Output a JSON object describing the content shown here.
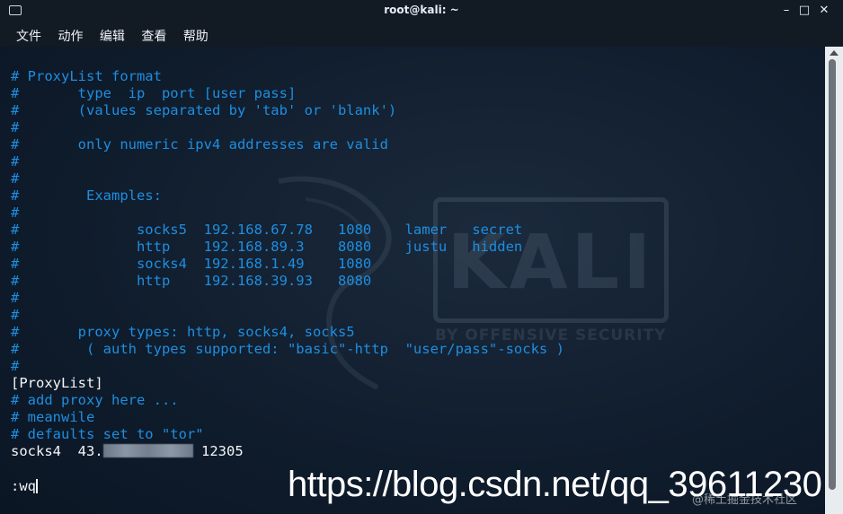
{
  "window": {
    "title": "root@kali: ~",
    "controls": {
      "minimize": "–",
      "maximize": "□",
      "close": "✕"
    }
  },
  "menu": [
    "文件",
    "动作",
    "编辑",
    "查看",
    "帮助"
  ],
  "terminal": {
    "lines": [
      {
        "text": "# ProxyList format",
        "style": "comment"
      },
      {
        "text": "#       type  ip  port [user pass]",
        "style": "comment"
      },
      {
        "text": "#       (values separated by 'tab' or 'blank')",
        "style": "comment"
      },
      {
        "text": "#",
        "style": "comment"
      },
      {
        "text": "#       only numeric ipv4 addresses are valid",
        "style": "comment"
      },
      {
        "text": "#",
        "style": "comment"
      },
      {
        "text": "#",
        "style": "comment"
      },
      {
        "text": "#        Examples:",
        "style": "comment"
      },
      {
        "text": "#",
        "style": "comment"
      },
      {
        "text": "#              socks5  192.168.67.78   1080    lamer   secret",
        "style": "comment"
      },
      {
        "text": "#              http    192.168.89.3    8080    justu   hidden",
        "style": "comment"
      },
      {
        "text": "#              socks4  192.168.1.49    1080",
        "style": "comment"
      },
      {
        "text": "#              http    192.168.39.93   8080",
        "style": "comment"
      },
      {
        "text": "#",
        "style": "comment"
      },
      {
        "text": "#",
        "style": "comment"
      },
      {
        "text": "#       proxy types: http, socks4, socks5",
        "style": "comment"
      },
      {
        "text": "#        ( auth types supported: \"basic\"-http  \"user/pass\"-socks )",
        "style": "comment"
      },
      {
        "text": "#",
        "style": "comment"
      },
      {
        "text": "[ProxyList]",
        "style": "plain"
      },
      {
        "text": "# add proxy here ...",
        "style": "comment"
      },
      {
        "text": "# meanwile",
        "style": "comment"
      },
      {
        "text": "# defaults set to \"tor\"",
        "style": "comment"
      }
    ],
    "proxy_entry": {
      "prefix": "socks4  43.",
      "suffix": " 12305"
    },
    "command": ":wq"
  },
  "overlay": {
    "kali_logo_text": "KALI",
    "kali_tagline": "BY OFFENSIVE SECURITY",
    "url": "https://blog.csdn.net/qq_39611230",
    "site_mark": "@稀土掘金技术社区"
  },
  "colors": {
    "comment": "#1e8ee0",
    "plain": "#f4f6f8",
    "background": "#0e1b2b"
  }
}
